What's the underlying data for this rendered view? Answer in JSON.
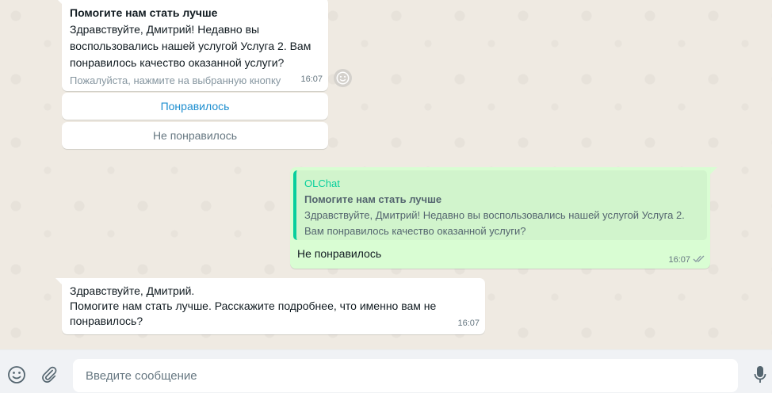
{
  "messages": {
    "incoming1": {
      "title": "Помогите нам стать лучше",
      "text": "Здравствуйте, Дмитрий! Недавно вы воспользовались нашей услугой Услуга 2. Вам понравилось качество оказанной услуги?",
      "footer": "Пожалуйста, нажмите на выбранную кнопку",
      "time": "16:07"
    },
    "quick_replies": [
      {
        "label": "Понравилось"
      },
      {
        "label": "Не понравилось"
      }
    ],
    "outgoing": {
      "quote_author": "OLChat",
      "quote_title": "Помогите нам стать лучше",
      "quote_line1": "Здравствуйте, Дмитрий! Недавно вы воспользовались нашей услугой Услуга 2.",
      "quote_line2": "Вам понравилось качество оказанной услуги?",
      "text": "Не понравилось",
      "time": "16:07",
      "status_icon": "double-check-icon"
    },
    "incoming2": {
      "line1": "Здравствуйте, Дмитрий.",
      "line2": "Помогите нам стать лучше. Расскажите подробнее, что именно вам не понравилось?",
      "time": "16:07"
    }
  },
  "composer": {
    "placeholder": "Введите сообщение",
    "emoji_icon": "emoji-icon",
    "attach_icon": "paperclip-icon",
    "mic_icon": "microphone-icon"
  },
  "colors": {
    "outgoing_bg": "#d9fdd3",
    "quote_accent": "#06cf9c",
    "link_button": "#1d8ecf"
  }
}
